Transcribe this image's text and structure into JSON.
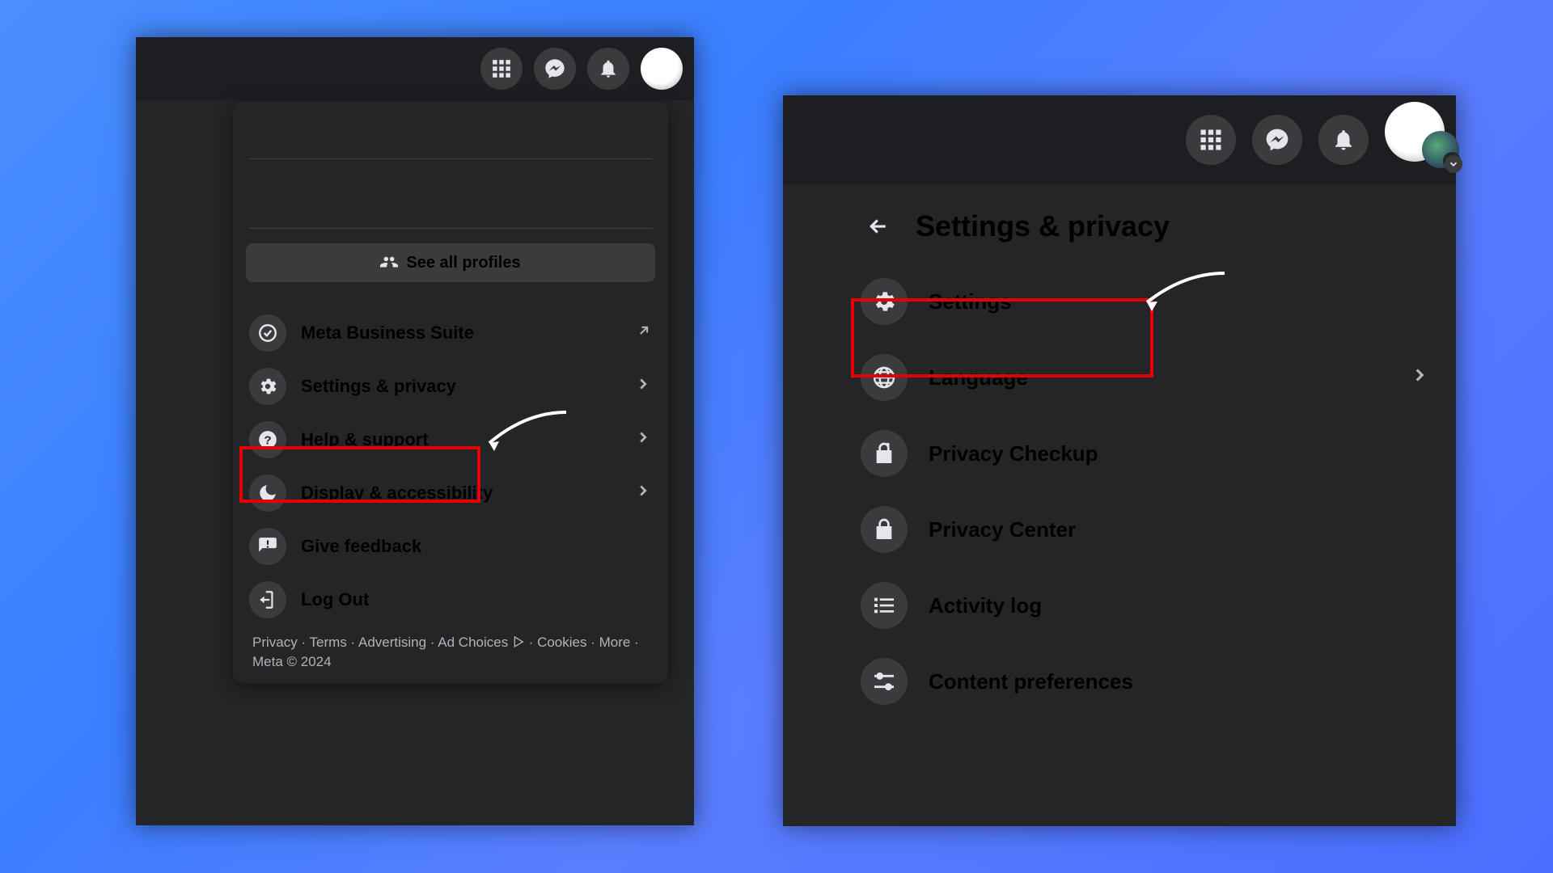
{
  "panel1": {
    "see_all_profiles": "See all profiles",
    "items": [
      {
        "label": "Meta Business Suite"
      },
      {
        "label": "Settings & privacy"
      },
      {
        "label": "Help & support"
      },
      {
        "label": "Display & accessibility"
      },
      {
        "label": "Give feedback"
      },
      {
        "label": "Log Out"
      }
    ],
    "footer": {
      "privacy": "Privacy",
      "terms": "Terms",
      "advertising": "Advertising",
      "ad_choices": "Ad Choices",
      "cookies": "Cookies",
      "more": "More",
      "copyright": "Meta © 2024"
    }
  },
  "panel2": {
    "title": "Settings & privacy",
    "items": [
      {
        "label": "Settings"
      },
      {
        "label": "Language"
      },
      {
        "label": "Privacy Checkup"
      },
      {
        "label": "Privacy Center"
      },
      {
        "label": "Activity log"
      },
      {
        "label": "Content preferences"
      }
    ]
  }
}
